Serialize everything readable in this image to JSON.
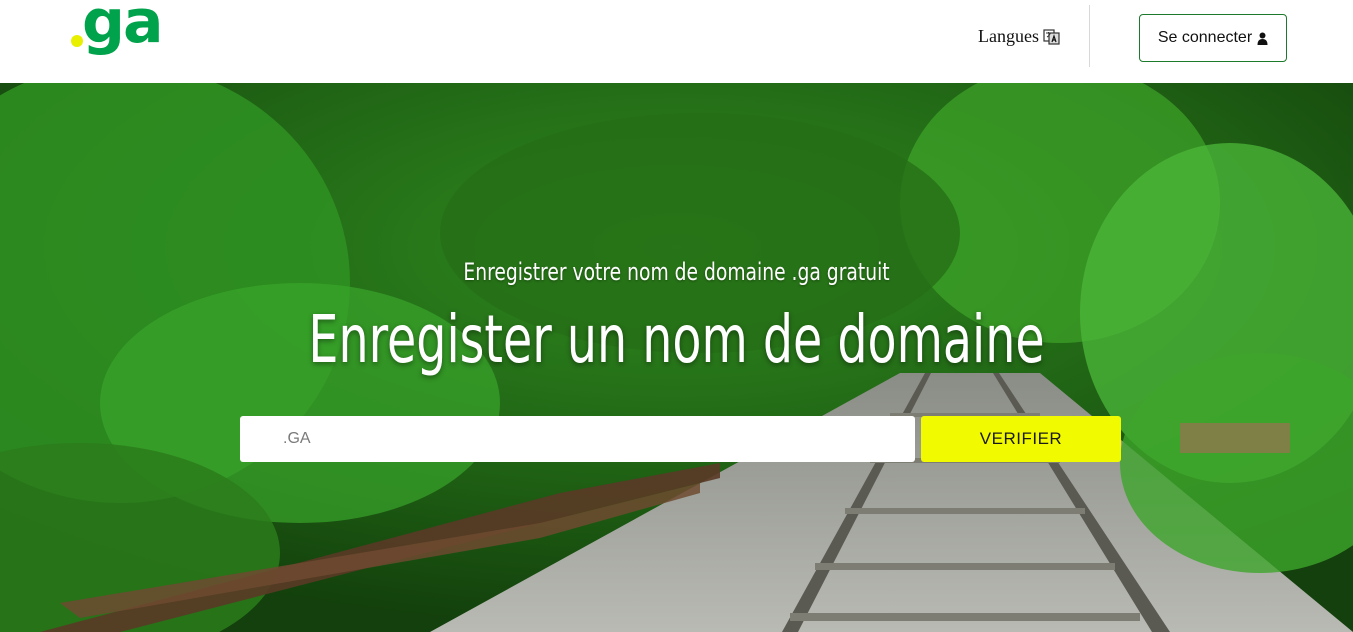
{
  "header": {
    "logo_text": "ga",
    "languages_label": "Langues",
    "login_label": "Se connecter"
  },
  "hero": {
    "subtitle": "Enregistrer votre nom de domaine .ga gratuit",
    "title": "Enregister un nom de domaine",
    "search_placeholder": ".GA",
    "verify_label": "VERIFIER"
  },
  "colors": {
    "brand_green": "#00a24b",
    "brand_yellow": "#f2fa00",
    "logo_dot": "#e8f000",
    "login_border": "#1c7a2c"
  },
  "icons": {
    "languages": "translate-icon",
    "login": "user-icon"
  }
}
